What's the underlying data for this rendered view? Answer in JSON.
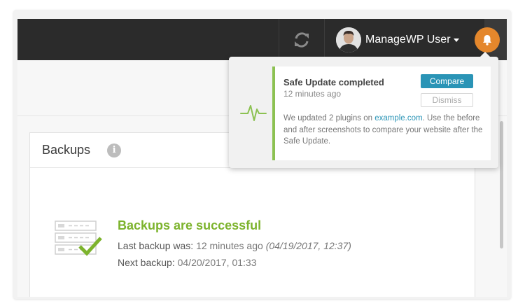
{
  "header": {
    "user_name": "ManageWP User",
    "refresh_icon": "refresh-icon",
    "bell_icon": "bell-icon",
    "bell_color": "#e4872c",
    "bar_color": "#2b2b2b"
  },
  "backups": {
    "title": "Backups",
    "info_icon_glyph": "i",
    "status_title": "Backups are successful",
    "status_color": "#7cb32c",
    "last_label": "Last backup was:",
    "last_relative": "12 minutes ago",
    "last_absolute": "(04/19/2017, 12:37)",
    "next_label": "Next backup:",
    "next_value": "04/20/2017, 01:33"
  },
  "notification": {
    "title": "Safe Update completed",
    "time": "12 minutes ago",
    "compare_label": "Compare",
    "dismiss_label": "Dismiss",
    "body_before_link": "We updated 2 plugins on ",
    "link_text": "example.com",
    "body_after_link": ". Use the before and after screenshots to compare your website after the Safe Update.",
    "accent_color": "#8cc152",
    "button_color": "#2a94b6"
  }
}
